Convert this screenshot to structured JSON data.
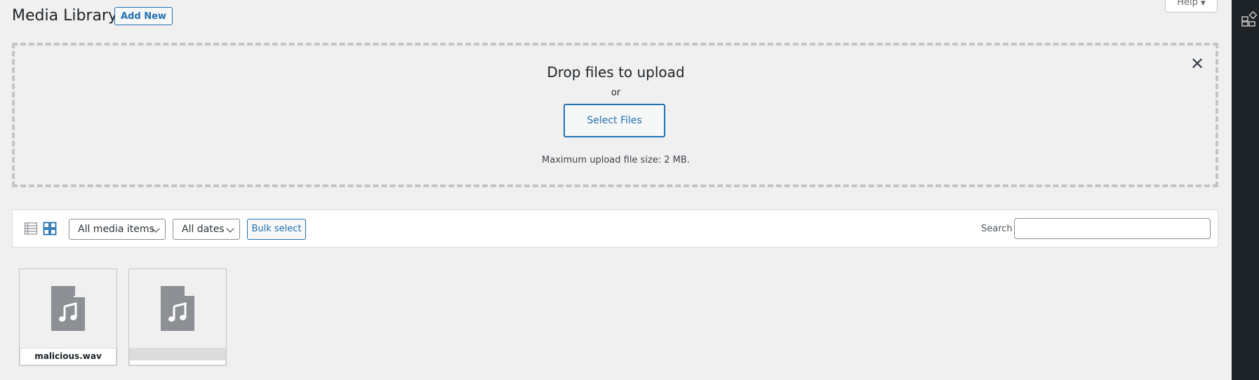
{
  "header": {
    "title": "Media Library",
    "add_new_label": "Add New",
    "help_label": "Help"
  },
  "uploader": {
    "drop_title": "Drop files to upload",
    "or_text": "or",
    "select_files_label": "Select Files",
    "max_size_text": "Maximum upload file size: 2 MB."
  },
  "toolbar": {
    "view_modes": [
      "list-view-icon",
      "grid-view-icon"
    ],
    "active_view": "grid",
    "media_filter": "All media items",
    "date_filter": "All dates",
    "bulk_select_label": "Bulk select",
    "search_label": "Search",
    "search_value": ""
  },
  "attachments": [
    {
      "filename": "malicious.wav",
      "icon": "audio-file-icon"
    },
    {
      "filename": "",
      "icon": "audio-file-icon"
    }
  ],
  "colors": {
    "accent": "#2271b1",
    "background": "#f0f0f1",
    "sidebar_dark": "#1d2327",
    "file_icon": "#8c8f94"
  }
}
